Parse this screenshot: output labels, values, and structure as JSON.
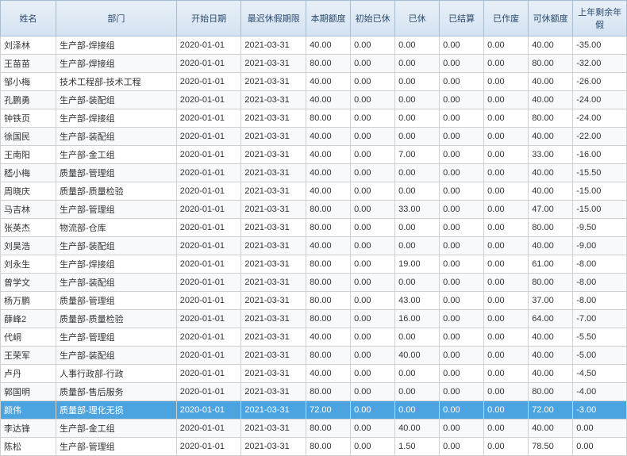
{
  "headers": {
    "name": "姓名",
    "dept": "部门",
    "start": "开始日期",
    "deadline": "最迟休假期限",
    "quota": "本期额度",
    "initial": "初始已休",
    "taken": "已休",
    "settled": "已结算",
    "void": "已作废",
    "avail": "可休额度",
    "remain": "上年剩余年假"
  },
  "selectedIndex": 20,
  "rows": [
    {
      "name": "刘泽林",
      "dept": "生产部-焊接组",
      "start": "2020-01-01",
      "deadline": "2021-03-31",
      "quota": "40.00",
      "initial": "0.00",
      "taken": "0.00",
      "settled": "0.00",
      "void": "0.00",
      "avail": "40.00",
      "remain": "-35.00"
    },
    {
      "name": "王苗苗",
      "dept": "生产部-焊接组",
      "start": "2020-01-01",
      "deadline": "2021-03-31",
      "quota": "80.00",
      "initial": "0.00",
      "taken": "0.00",
      "settled": "0.00",
      "void": "0.00",
      "avail": "80.00",
      "remain": "-32.00"
    },
    {
      "name": "邹小梅",
      "dept": "技术工程部-技术工程",
      "start": "2020-01-01",
      "deadline": "2021-03-31",
      "quota": "40.00",
      "initial": "0.00",
      "taken": "0.00",
      "settled": "0.00",
      "void": "0.00",
      "avail": "40.00",
      "remain": "-26.00"
    },
    {
      "name": "孔鹏勇",
      "dept": "生产部-装配组",
      "start": "2020-01-01",
      "deadline": "2021-03-31",
      "quota": "40.00",
      "initial": "0.00",
      "taken": "0.00",
      "settled": "0.00",
      "void": "0.00",
      "avail": "40.00",
      "remain": "-24.00"
    },
    {
      "name": "钟铁页",
      "dept": "生产部-焊接组",
      "start": "2020-01-01",
      "deadline": "2021-03-31",
      "quota": "80.00",
      "initial": "0.00",
      "taken": "0.00",
      "settled": "0.00",
      "void": "0.00",
      "avail": "80.00",
      "remain": "-24.00"
    },
    {
      "name": "徐国民",
      "dept": "生产部-装配组",
      "start": "2020-01-01",
      "deadline": "2021-03-31",
      "quota": "40.00",
      "initial": "0.00",
      "taken": "0.00",
      "settled": "0.00",
      "void": "0.00",
      "avail": "40.00",
      "remain": "-22.00"
    },
    {
      "name": "王南阳",
      "dept": "生产部-金工组",
      "start": "2020-01-01",
      "deadline": "2021-03-31",
      "quota": "40.00",
      "initial": "0.00",
      "taken": "7.00",
      "settled": "0.00",
      "void": "0.00",
      "avail": "33.00",
      "remain": "-16.00"
    },
    {
      "name": "嵇小梅",
      "dept": "质量部-管理组",
      "start": "2020-01-01",
      "deadline": "2021-03-31",
      "quota": "40.00",
      "initial": "0.00",
      "taken": "0.00",
      "settled": "0.00",
      "void": "0.00",
      "avail": "40.00",
      "remain": "-15.50"
    },
    {
      "name": "周晓庆",
      "dept": "质量部-质量检验",
      "start": "2020-01-01",
      "deadline": "2021-03-31",
      "quota": "40.00",
      "initial": "0.00",
      "taken": "0.00",
      "settled": "0.00",
      "void": "0.00",
      "avail": "40.00",
      "remain": "-15.00"
    },
    {
      "name": "马吉林",
      "dept": "生产部-管理组",
      "start": "2020-01-01",
      "deadline": "2021-03-31",
      "quota": "80.00",
      "initial": "0.00",
      "taken": "33.00",
      "settled": "0.00",
      "void": "0.00",
      "avail": "47.00",
      "remain": "-15.00"
    },
    {
      "name": "张英杰",
      "dept": "物流部-仓库",
      "start": "2020-01-01",
      "deadline": "2021-03-31",
      "quota": "80.00",
      "initial": "0.00",
      "taken": "0.00",
      "settled": "0.00",
      "void": "0.00",
      "avail": "80.00",
      "remain": "-9.50"
    },
    {
      "name": "刘昊浩",
      "dept": "生产部-装配组",
      "start": "2020-01-01",
      "deadline": "2021-03-31",
      "quota": "40.00",
      "initial": "0.00",
      "taken": "0.00",
      "settled": "0.00",
      "void": "0.00",
      "avail": "40.00",
      "remain": "-9.00"
    },
    {
      "name": "刘永生",
      "dept": "生产部-焊接组",
      "start": "2020-01-01",
      "deadline": "2021-03-31",
      "quota": "80.00",
      "initial": "0.00",
      "taken": "19.00",
      "settled": "0.00",
      "void": "0.00",
      "avail": "61.00",
      "remain": "-8.00"
    },
    {
      "name": "曾学文",
      "dept": "生产部-装配组",
      "start": "2020-01-01",
      "deadline": "2021-03-31",
      "quota": "80.00",
      "initial": "0.00",
      "taken": "0.00",
      "settled": "0.00",
      "void": "0.00",
      "avail": "80.00",
      "remain": "-8.00"
    },
    {
      "name": "杨万鹏",
      "dept": "质量部-管理组",
      "start": "2020-01-01",
      "deadline": "2021-03-31",
      "quota": "80.00",
      "initial": "0.00",
      "taken": "43.00",
      "settled": "0.00",
      "void": "0.00",
      "avail": "37.00",
      "remain": "-8.00"
    },
    {
      "name": "薛峰2",
      "dept": "质量部-质量检验",
      "start": "2020-01-01",
      "deadline": "2021-03-31",
      "quota": "80.00",
      "initial": "0.00",
      "taken": "16.00",
      "settled": "0.00",
      "void": "0.00",
      "avail": "64.00",
      "remain": "-7.00"
    },
    {
      "name": "代峒",
      "dept": "生产部-管理组",
      "start": "2020-01-01",
      "deadline": "2021-03-31",
      "quota": "40.00",
      "initial": "0.00",
      "taken": "0.00",
      "settled": "0.00",
      "void": "0.00",
      "avail": "40.00",
      "remain": "-5.50"
    },
    {
      "name": "王荣军",
      "dept": "生产部-装配组",
      "start": "2020-01-01",
      "deadline": "2021-03-31",
      "quota": "80.00",
      "initial": "0.00",
      "taken": "40.00",
      "settled": "0.00",
      "void": "0.00",
      "avail": "40.00",
      "remain": "-5.00"
    },
    {
      "name": "卢丹",
      "dept": "人事行政部-行政",
      "start": "2020-01-01",
      "deadline": "2021-03-31",
      "quota": "40.00",
      "initial": "0.00",
      "taken": "0.00",
      "settled": "0.00",
      "void": "0.00",
      "avail": "40.00",
      "remain": "-4.50"
    },
    {
      "name": "郭国明",
      "dept": "质量部-售后服务",
      "start": "2020-01-01",
      "deadline": "2021-03-31",
      "quota": "80.00",
      "initial": "0.00",
      "taken": "0.00",
      "settled": "0.00",
      "void": "0.00",
      "avail": "80.00",
      "remain": "-4.00"
    },
    {
      "name": "颜伟",
      "dept": "质量部-理化无损",
      "start": "2020-01-01",
      "deadline": "2021-03-31",
      "quota": "72.00",
      "initial": "0.00",
      "taken": "0.00",
      "settled": "0.00",
      "void": "0.00",
      "avail": "72.00",
      "remain": "-3.00"
    },
    {
      "name": "李达锋",
      "dept": "生产部-金工组",
      "start": "2020-01-01",
      "deadline": "2021-03-31",
      "quota": "80.00",
      "initial": "0.00",
      "taken": "40.00",
      "settled": "0.00",
      "void": "0.00",
      "avail": "40.00",
      "remain": "0.00"
    },
    {
      "name": "陈松",
      "dept": "生产部-管理组",
      "start": "2020-01-01",
      "deadline": "2021-03-31",
      "quota": "80.00",
      "initial": "0.00",
      "taken": "1.50",
      "settled": "0.00",
      "void": "0.00",
      "avail": "78.50",
      "remain": "0.00"
    }
  ]
}
